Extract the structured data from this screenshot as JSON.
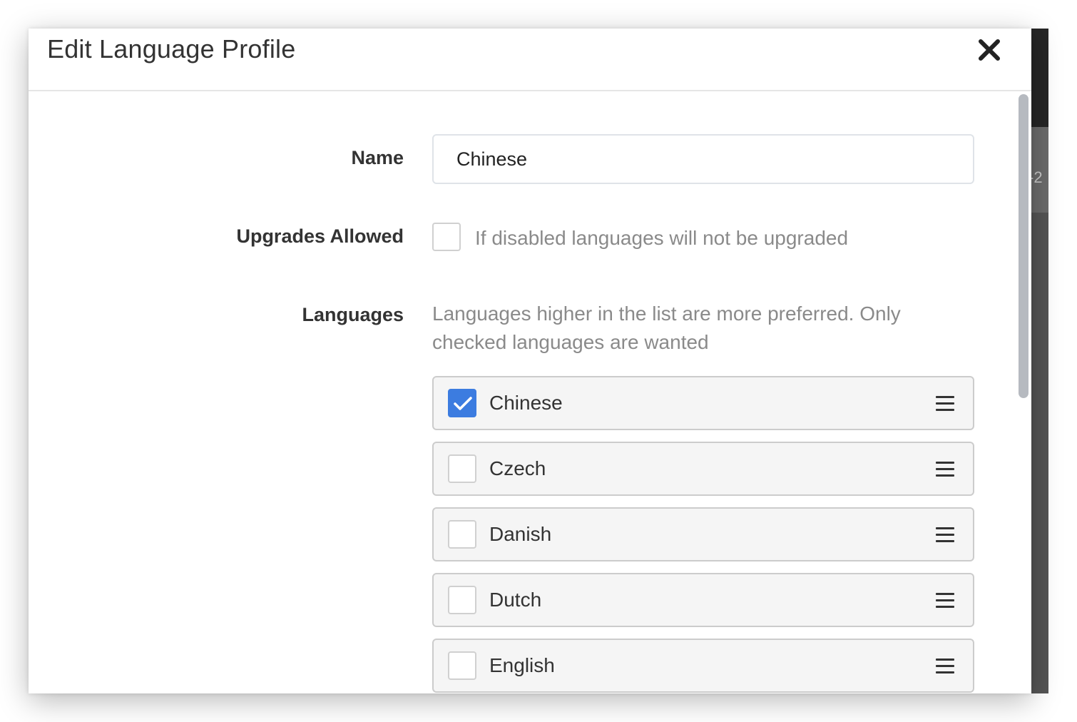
{
  "modal": {
    "title": "Edit Language Profile",
    "close_label": "close"
  },
  "form": {
    "name": {
      "label": "Name",
      "value": "Chinese"
    },
    "upgrades_allowed": {
      "label": "Upgrades Allowed",
      "checked": false,
      "help_text": "If disabled languages will not be upgraded"
    },
    "languages": {
      "label": "Languages",
      "help_text": "Languages higher in the list are more preferred. Only checked languages are wanted",
      "items": [
        {
          "label": "Chinese",
          "checked": true
        },
        {
          "label": "Czech",
          "checked": false
        },
        {
          "label": "Danish",
          "checked": false
        },
        {
          "label": "Dutch",
          "checked": false
        },
        {
          "label": "English",
          "checked": false
        }
      ]
    }
  },
  "background": {
    "partial_text": "-2"
  },
  "icons": {
    "close": "close-icon",
    "check": "check-icon",
    "drag": "drag-handle-icon"
  },
  "colors": {
    "accent": "#3c7ce0",
    "help_text": "#8a8a8a",
    "item_background": "#f5f5f5"
  }
}
